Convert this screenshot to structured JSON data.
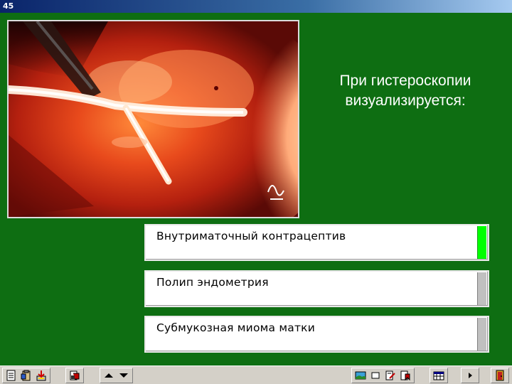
{
  "window": {
    "title": "45"
  },
  "question": {
    "line1": "При гистероскопии",
    "line2": "визуализируется:"
  },
  "answers": [
    {
      "label": "Внутриматочный контрацептив",
      "selected": true
    },
    {
      "label": "Полип эндометрия",
      "selected": false
    },
    {
      "label": "Субмукозная миома матки",
      "selected": false
    }
  ],
  "colors": {
    "background": "#0e6e12",
    "selected_indicator": "#00ff00",
    "unselected_indicator": "#c0c0c0",
    "titlebar": "#0a246a"
  },
  "toolbar": {
    "left_icons": [
      "notes-icon",
      "clipboard-icon",
      "download-icon"
    ],
    "middle_icons": [
      "print-preview-icon"
    ],
    "nav_icons": [
      "arrow-up-icon",
      "arrow-down-icon"
    ],
    "right_icons": [
      "picture-icon",
      "window-icon",
      "edit-page-icon",
      "bookmark-icon"
    ],
    "calendar_icon": "calendar-icon",
    "play_icon": "play-icon",
    "exit_icon": "exit-door-icon"
  }
}
